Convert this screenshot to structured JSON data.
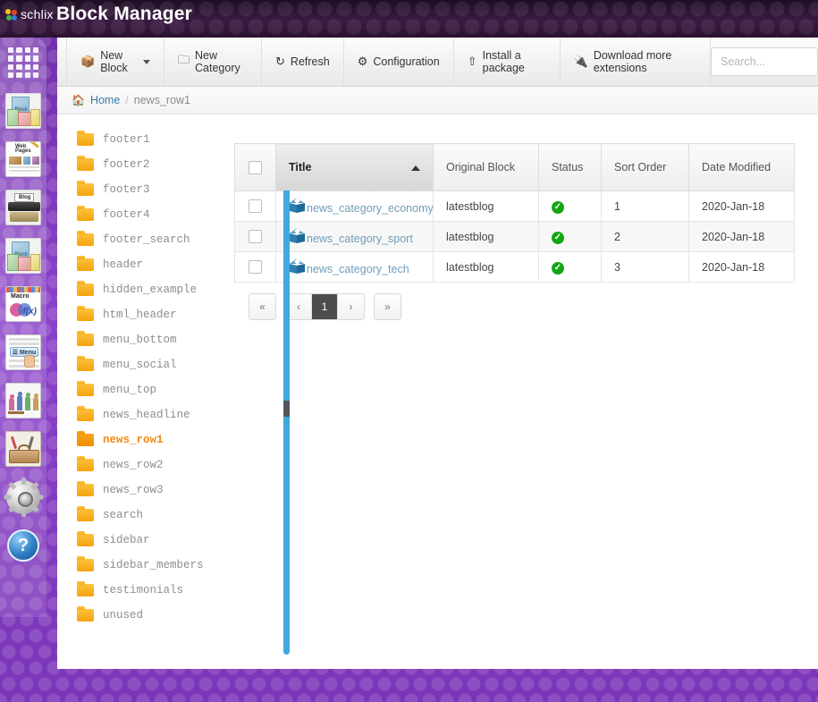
{
  "header": {
    "logo_text": "schlix",
    "logo_icon": "pinwheel-icon",
    "title": "Block Manager"
  },
  "rail": {
    "items": [
      {
        "name": "dashboard-grid",
        "icon": "grid-icon",
        "label": ""
      },
      {
        "name": "blocks",
        "icon": "block-icon",
        "label": "Block"
      },
      {
        "name": "web-pages",
        "icon": "web-pages-icon",
        "label": "Web Pages"
      },
      {
        "name": "blog",
        "icon": "blog-typewriter-icon",
        "label": "Blog"
      },
      {
        "name": "blocks-2",
        "icon": "block-icon",
        "label": "Block"
      },
      {
        "name": "macro",
        "icon": "macro-icon",
        "label": "Macro"
      },
      {
        "name": "menu",
        "icon": "menu-icon",
        "label": "Menu"
      },
      {
        "name": "users",
        "icon": "users-icon",
        "label": ""
      },
      {
        "name": "tools",
        "icon": "toolbox-icon",
        "label": ""
      },
      {
        "name": "settings",
        "icon": "gear-icon",
        "label": ""
      },
      {
        "name": "help",
        "icon": "help-icon",
        "label": "?"
      }
    ]
  },
  "toolbar": {
    "buttons": [
      {
        "label": "New Block",
        "icon": "cube-icon",
        "has_caret": true
      },
      {
        "label": "New Category",
        "icon": "folder-icon",
        "has_caret": false
      },
      {
        "label": "Refresh",
        "icon": "refresh-icon",
        "has_caret": false
      },
      {
        "label": "Configuration",
        "icon": "gear-icon",
        "has_caret": false
      },
      {
        "label": "Install a package",
        "icon": "upload-icon",
        "has_caret": false
      },
      {
        "label": "Download more extensions",
        "icon": "puzzle-plug-icon",
        "has_caret": false
      }
    ],
    "search_placeholder": "Search...",
    "search_value": ""
  },
  "breadcrumb": {
    "home_label": "Home",
    "separator": "/",
    "current": "news_row1"
  },
  "folders": {
    "items": [
      {
        "label": "footer1",
        "active": false
      },
      {
        "label": "footer2",
        "active": false
      },
      {
        "label": "footer3",
        "active": false
      },
      {
        "label": "footer4",
        "active": false
      },
      {
        "label": "footer_search",
        "active": false
      },
      {
        "label": "header",
        "active": false
      },
      {
        "label": "hidden_example",
        "active": false
      },
      {
        "label": "html_header",
        "active": false
      },
      {
        "label": "menu_bottom",
        "active": false
      },
      {
        "label": "menu_social",
        "active": false
      },
      {
        "label": "menu_top",
        "active": false
      },
      {
        "label": "news_headline",
        "active": false
      },
      {
        "label": "news_row1",
        "active": true
      },
      {
        "label": "news_row2",
        "active": false
      },
      {
        "label": "news_row3",
        "active": false
      },
      {
        "label": "search",
        "active": false
      },
      {
        "label": "sidebar",
        "active": false
      },
      {
        "label": "sidebar_members",
        "active": false
      },
      {
        "label": "testimonials",
        "active": false
      },
      {
        "label": "unused",
        "active": false
      }
    ]
  },
  "table": {
    "columns": [
      "",
      "Title",
      "Original Block",
      "Status",
      "Sort Order",
      "Date Modified"
    ],
    "sorted_column": "Title",
    "sort_direction": "asc",
    "rows": [
      {
        "title": "news_category_economy",
        "original_block": "latestblog",
        "status": "enabled",
        "sort_order": "1",
        "date_modified": "2020-Jan-18"
      },
      {
        "title": "news_category_sport",
        "original_block": "latestblog",
        "status": "enabled",
        "sort_order": "2",
        "date_modified": "2020-Jan-18"
      },
      {
        "title": "news_category_tech",
        "original_block": "latestblog",
        "status": "enabled",
        "sort_order": "3",
        "date_modified": "2020-Jan-18"
      }
    ]
  },
  "pagination": {
    "first": "«",
    "prev": "‹",
    "current_page": "1",
    "next": "›",
    "last": "»"
  },
  "colors": {
    "accent_orange": "#f08a13",
    "link_blue": "#6f9cb8",
    "status_green": "#13a613",
    "scrollbar_blue": "#3fa9e0",
    "header_purple": "#2b1230",
    "page_purple": "#7a34b5"
  }
}
